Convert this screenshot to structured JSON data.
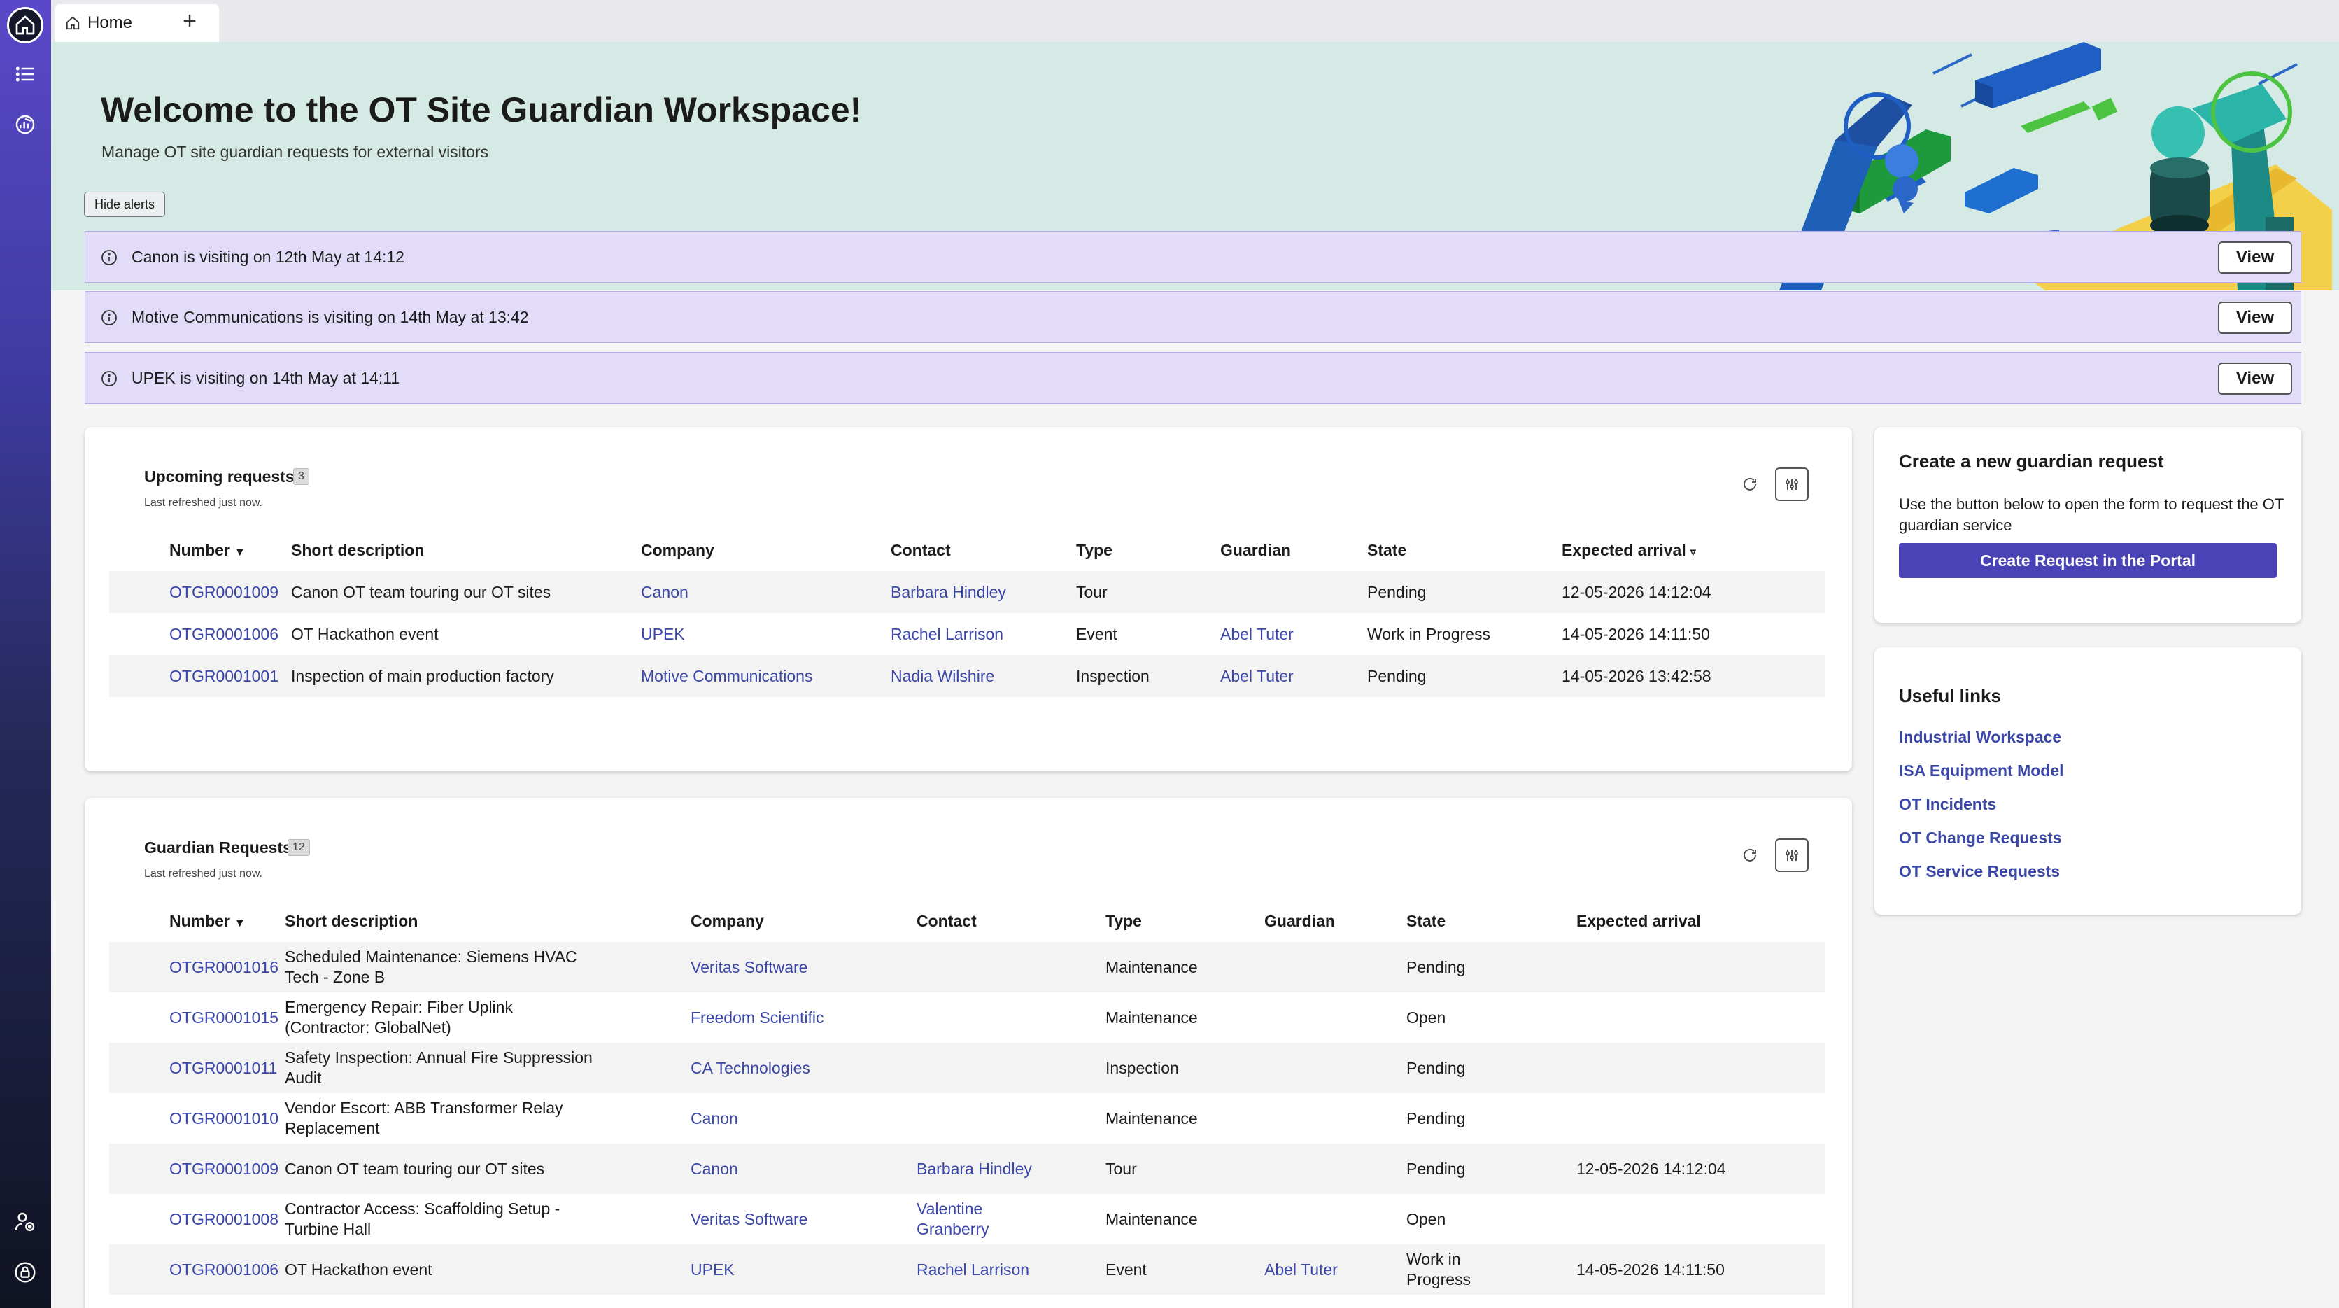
{
  "tabs": [
    {
      "label": "Home"
    }
  ],
  "hero": {
    "title": "Welcome to the OT Site Guardian Workspace!",
    "subtitle": "Manage OT site guardian requests for external visitors",
    "hide_alerts_label": "Hide alerts"
  },
  "alerts": [
    {
      "text": "Canon is visiting on 12th May at 14:12",
      "button": "View"
    },
    {
      "text": "Motive Communications is visiting on 14th May at 13:42",
      "button": "View"
    },
    {
      "text": "UPEK is visiting on 14th May at 14:11",
      "button": "View"
    }
  ],
  "upcoming": {
    "title": "Upcoming requests",
    "count": "3",
    "refreshed": "Last refreshed just now.",
    "columns": [
      "Number",
      "Short description",
      "Company",
      "Contact",
      "Type",
      "Guardian",
      "State",
      "Expected arrival"
    ],
    "rows": [
      {
        "number": "OTGR0001009",
        "desc": "Canon OT team touring our OT sites",
        "company": "Canon",
        "contact": "Barbara Hindley",
        "type": "Tour",
        "guardian": "",
        "state": "Pending",
        "arrival": "12-05-2026 14:12:04"
      },
      {
        "number": "OTGR0001006",
        "desc": "OT Hackathon event",
        "company": "UPEK",
        "contact": "Rachel Larrison",
        "type": "Event",
        "guardian": "Abel Tuter",
        "state": "Work in Progress",
        "arrival": "14-05-2026 14:11:50"
      },
      {
        "number": "OTGR0001001",
        "desc": "Inspection of main production factory",
        "company": "Motive Communications",
        "contact": "Nadia Wilshire",
        "type": "Inspection",
        "guardian": "Abel Tuter",
        "state": "Pending",
        "arrival": "14-05-2026 13:42:58"
      }
    ]
  },
  "guardian": {
    "title": "Guardian Requests",
    "count": "12",
    "refreshed": "Last refreshed just now.",
    "columns": [
      "Number",
      "Short description",
      "Company",
      "Contact",
      "Type",
      "Guardian",
      "State",
      "Expected arrival"
    ],
    "rows": [
      {
        "number": "OTGR0001016",
        "desc": "Scheduled Maintenance: Siemens HVAC Tech - Zone B",
        "company": "Veritas Software",
        "contact": "",
        "type": "Maintenance",
        "guardian": "",
        "state": "Pending",
        "arrival": ""
      },
      {
        "number": "OTGR0001015",
        "desc": "Emergency Repair: Fiber Uplink (Contractor: GlobalNet)",
        "company": "Freedom Scientific",
        "contact": "",
        "type": "Maintenance",
        "guardian": "",
        "state": "Open",
        "arrival": ""
      },
      {
        "number": "OTGR0001011",
        "desc": "Safety Inspection: Annual Fire Suppression Audit",
        "company": "CA Technologies",
        "contact": "",
        "type": "Inspection",
        "guardian": "",
        "state": "Pending",
        "arrival": ""
      },
      {
        "number": "OTGR0001010",
        "desc": "Vendor Escort: ABB Transformer Relay Replacement",
        "company": "Canon",
        "contact": "",
        "type": "Maintenance",
        "guardian": "",
        "state": "Pending",
        "arrival": ""
      },
      {
        "number": "OTGR0001009",
        "desc": "Canon OT team touring our OT sites",
        "company": "Canon",
        "contact": "Barbara Hindley",
        "type": "Tour",
        "guardian": "",
        "state": "Pending",
        "arrival": "12-05-2026 14:12:04"
      },
      {
        "number": "OTGR0001008",
        "desc": "Contractor Access: Scaffolding Setup - Turbine Hall",
        "company": "Veritas Software",
        "contact": "Valentine Granberry",
        "type": "Maintenance",
        "guardian": "",
        "state": "Open",
        "arrival": ""
      },
      {
        "number": "OTGR0001006",
        "desc": "OT Hackathon event",
        "company": "UPEK",
        "contact": "Rachel Larrison",
        "type": "Event",
        "guardian": "Abel Tuter",
        "state": "Work in Progress",
        "arrival": "14-05-2026 14:11:50"
      }
    ]
  },
  "create": {
    "title": "Create a new guardian request",
    "description": "Use the button below to open the form to request the OT guardian service",
    "button": "Create Request in the Portal"
  },
  "useful": {
    "title": "Useful links",
    "links": [
      "Industrial Workspace",
      "ISA Equipment Model",
      "OT Incidents",
      "OT Change Requests",
      "OT Service Requests"
    ]
  }
}
